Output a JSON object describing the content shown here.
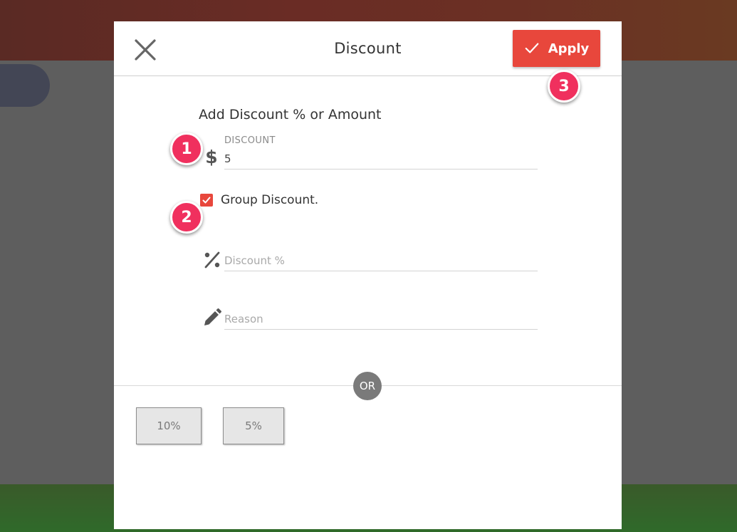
{
  "modal": {
    "title": "Discount",
    "apply_label": "Apply"
  },
  "form": {
    "heading": "Add Discount % or Amount",
    "discount_label": "DISCOUNT",
    "currency_symbol": "$",
    "discount_value": "5",
    "group_discount_label": "Group Discount.",
    "group_discount_checked": true,
    "percent_placeholder": "Discount %",
    "reason_placeholder": "Reason"
  },
  "separator": {
    "label": "OR"
  },
  "presets": [
    {
      "label": "10%"
    },
    {
      "label": "5%"
    }
  ],
  "callouts": [
    "1",
    "2",
    "3"
  ],
  "colors": {
    "accent": "#e8473c",
    "callout": "#f0305e",
    "or_badge": "#7a7a7a"
  },
  "icons": {
    "close": "close-icon",
    "apply": "check-icon",
    "checkbox": "check-icon",
    "percent": "percent-icon",
    "reason": "pencil-icon"
  }
}
